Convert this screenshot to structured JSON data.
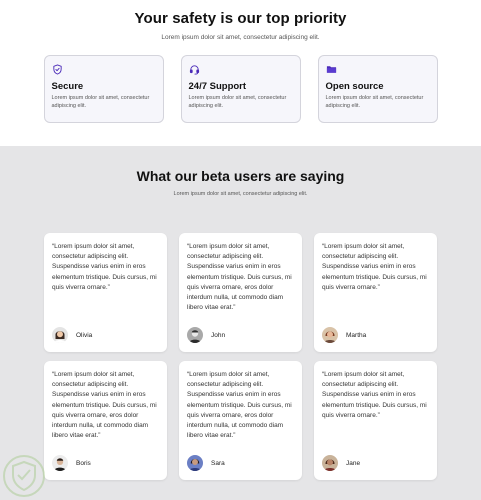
{
  "hero": {
    "title": "Your safety is our top priority",
    "subtitle": "Lorem ipsum dolor sit amet, consectetur adipiscing elit."
  },
  "features": [
    {
      "title": "Secure",
      "text": "Lorem ipsum dolor sit amet, consectetur adipiscing elit.",
      "icon": "shield-check-icon"
    },
    {
      "title": "24/7 Support",
      "text": "Lorem ipsum dolor sit amet, consectetur adipiscing elit.",
      "icon": "headset-icon"
    },
    {
      "title": "Open source",
      "text": "Lorem ipsum dolor sit amet, consectetur adipiscing elit.",
      "icon": "folder-icon"
    }
  ],
  "testimonials": {
    "title": "What our beta users are saying",
    "subtitle": "Lorem ipsum dolor sit amet, consectetur adipiscing elit.",
    "items": [
      {
        "quote": "“Lorem ipsum dolor sit amet, consectetur adipiscing elit. Suspendisse varius enim in eros elementum tristique. Duis cursus, mi quis viverra ornare.”",
        "name": "Olivia"
      },
      {
        "quote": "“Lorem ipsum dolor sit amet, consectetur adipiscing elit. Suspendisse varius enim in eros elementum tristique. Duis cursus, mi quis viverra ornare, eros dolor interdum nulla, ut commodo diam libero vitae erat.”",
        "name": "John"
      },
      {
        "quote": "“Lorem ipsum dolor sit amet, consectetur adipiscing elit. Suspendisse varius enim in eros elementum tristique. Duis cursus, mi quis viverra ornare.”",
        "name": "Martha"
      },
      {
        "quote": "“Lorem ipsum dolor sit amet, consectetur adipiscing elit. Suspendisse varius enim in eros elementum tristique. Duis cursus, mi quis viverra ornare, eros dolor interdum nulla, ut commodo diam libero vitae erat.”",
        "name": "Boris"
      },
      {
        "quote": "“Lorem ipsum dolor sit amet, consectetur adipiscing elit. Suspendisse varius enim in eros elementum tristique. Duis cursus, mi quis viverra ornare, eros dolor interdum nulla, ut commodo diam libero vitae erat.”",
        "name": "Sara"
      },
      {
        "quote": "“Lorem ipsum dolor sit amet, consectetur adipiscing elit. Suspendisse varius enim in eros elementum tristique. Duis cursus, mi quis viverra ornare.”",
        "name": "Jane"
      }
    ]
  },
  "colors": {
    "accent": "#4b2bb8",
    "lower_bg": "#e5e5e7",
    "feature_bg": "#f6f6fb"
  }
}
